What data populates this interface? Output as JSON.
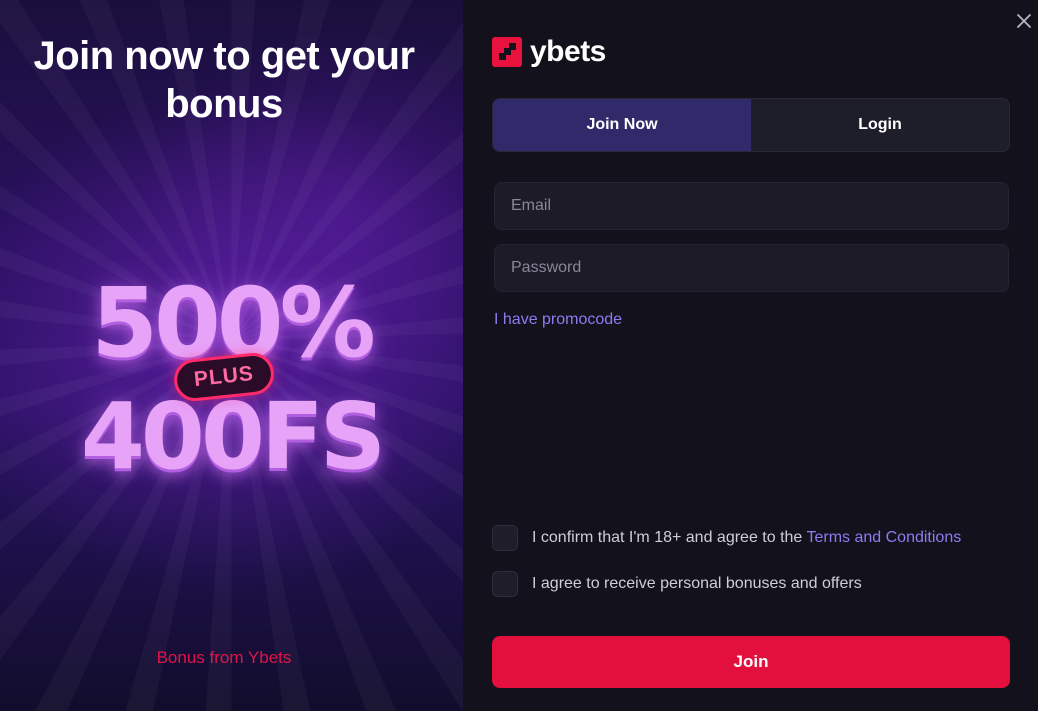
{
  "promo": {
    "title": "Join now to get your bonus",
    "headline_top": "500%",
    "badge": "PLUS",
    "headline_bottom": "400FS",
    "footer": "Bonus from Ybets"
  },
  "brand": {
    "name": "ybets",
    "logo_icon": "ybets-logo-icon",
    "accent_color": "#e8123f"
  },
  "tabs": [
    {
      "label": "Join Now",
      "active": true
    },
    {
      "label": "Login",
      "active": false
    }
  ],
  "form": {
    "email_placeholder": "Email",
    "password_placeholder": "Password",
    "promocode_link": "I have promocode",
    "confirm_text": "I confirm that I'm 18+ and agree to the ",
    "terms_link": "Terms and Conditions",
    "offers_text": "I agree to receive personal bonuses and offers",
    "submit_label": "Join"
  },
  "icons": {
    "close": "close-icon"
  }
}
